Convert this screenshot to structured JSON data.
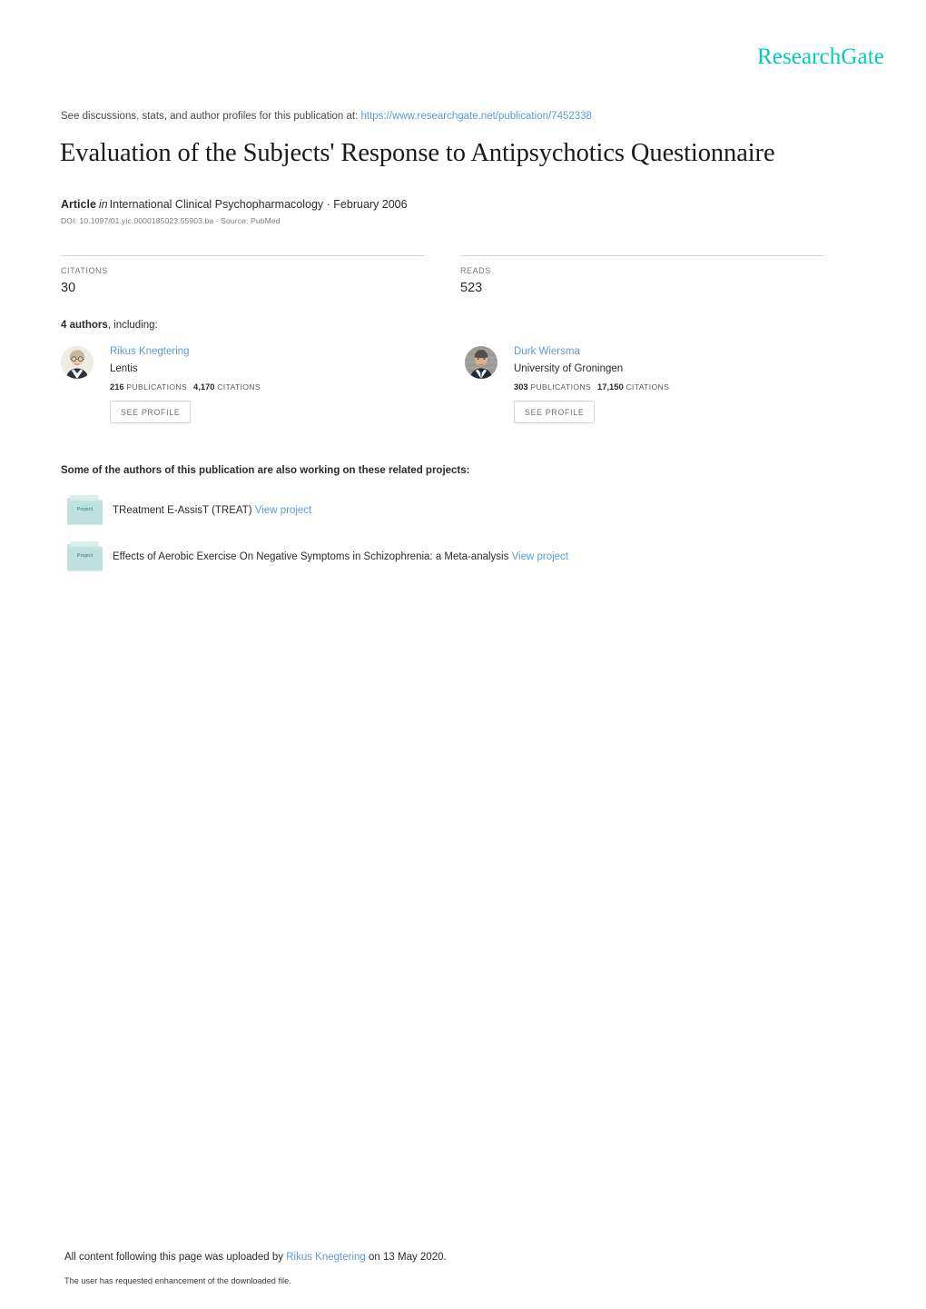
{
  "brand": {
    "logo_text": "ResearchGate",
    "logo_color": "#00ccbb"
  },
  "discussions": {
    "prefix": "See discussions, stats, and author profiles for this publication at:",
    "url": "https://www.researchgate.net/publication/7452338"
  },
  "publication": {
    "title": "Evaluation of the Subjects' Response to Antipsychotics Questionnaire",
    "type_label": "Article",
    "in_word": "in",
    "venue": "International Clinical Psychopharmacology · February 2006",
    "doi_line": "DOI: 10.1097/01.yic.0000185023.55903.ba · Source: PubMed"
  },
  "stats": [
    {
      "label": "CITATIONS",
      "value": "30"
    },
    {
      "label": "READS",
      "value": "523"
    }
  ],
  "authors_section": {
    "count_label": "4 authors",
    "suffix": ", including:",
    "see_profile_label": "SEE PROFILE",
    "publications_label": "PUBLICATIONS",
    "citations_label": "CITATIONS",
    "authors": [
      {
        "name": "Rikus Knegtering",
        "affiliation": "Lentis",
        "publications": "216",
        "citations": "4,170"
      },
      {
        "name": "Durk Wiersma",
        "affiliation": "University of Groningen",
        "publications": "303",
        "citations": "17,150"
      }
    ]
  },
  "projects_section": {
    "heading": "Some of the authors of this publication are also working on these related projects:",
    "folder_icon_label": "Project",
    "view_project_label": "View project",
    "projects": [
      {
        "title": "TReatment E-AssisT (TREAT)"
      },
      {
        "title": "Effects of Aerobic Exercise On Negative Symptoms in Schizophrenia: a Meta-analysis"
      }
    ]
  },
  "footer": {
    "upload_prefix": "All content following this page was uploaded by",
    "uploader": "Rikus Knegtering",
    "upload_suffix": "on 13 May 2020.",
    "enhancement_note": "The user has requested enhancement of the downloaded file."
  }
}
